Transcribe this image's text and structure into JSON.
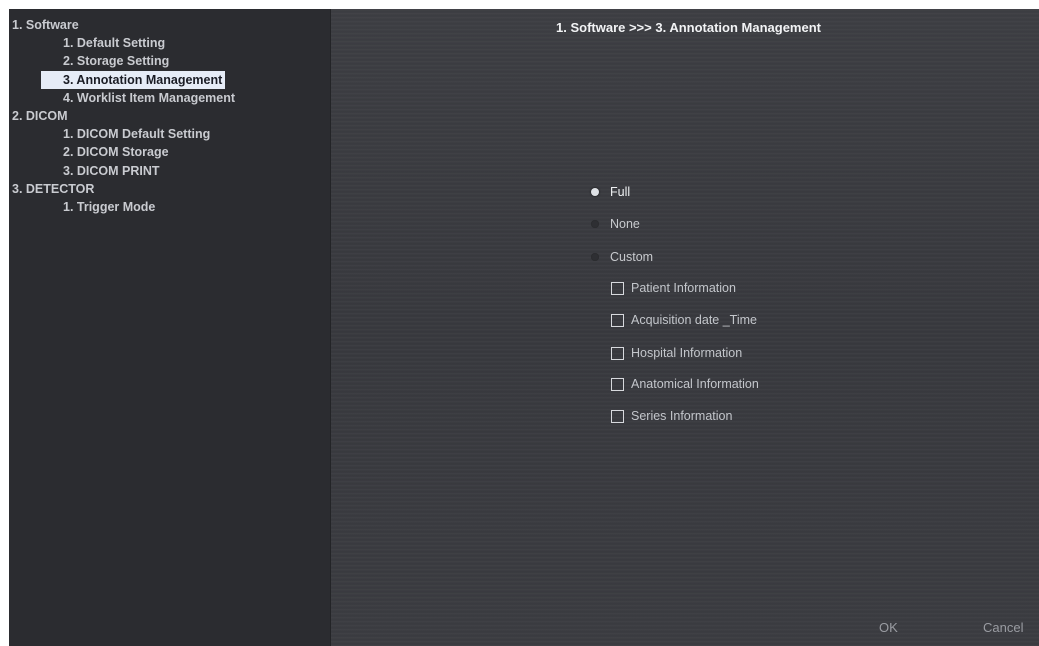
{
  "sidebar": {
    "items": [
      {
        "label": "1. Software",
        "level": 0
      },
      {
        "label": "1. Default Setting",
        "level": 1
      },
      {
        "label": "2. Storage Setting",
        "level": 1
      },
      {
        "label": "3. Annotation Management",
        "level": 1,
        "selected": true
      },
      {
        "label": "4. Worklist Item Management",
        "level": 1
      },
      {
        "label": "2. DICOM",
        "level": 0
      },
      {
        "label": "1. DICOM Default Setting",
        "level": 1
      },
      {
        "label": "2. DICOM Storage",
        "level": 1
      },
      {
        "label": "3. DICOM PRINT",
        "level": 1
      },
      {
        "label": "3. DETECTOR",
        "level": 0
      },
      {
        "label": "1. Trigger Mode",
        "level": 1
      }
    ]
  },
  "main": {
    "breadcrumb": "1. Software >>> 3. Annotation Management",
    "radio_options": [
      {
        "label": "Full",
        "selected": true
      },
      {
        "label": "None",
        "selected": false
      },
      {
        "label": "Custom",
        "selected": false
      }
    ],
    "custom_options": [
      {
        "label": "Patient Information",
        "checked": false
      },
      {
        "label": "Acquisition date _Time",
        "checked": false
      },
      {
        "label": "Hospital Information",
        "checked": false
      },
      {
        "label": "Anatomical Information",
        "checked": false
      },
      {
        "label": "Series Information",
        "checked": false
      }
    ]
  },
  "footer": {
    "ok_label": "OK",
    "cancel_label": "Cancel"
  },
  "colors": {
    "sidebar_bg": "#2b2c30",
    "main_bg": "#3a3b40",
    "selection_bg": "#e6ecf7"
  }
}
